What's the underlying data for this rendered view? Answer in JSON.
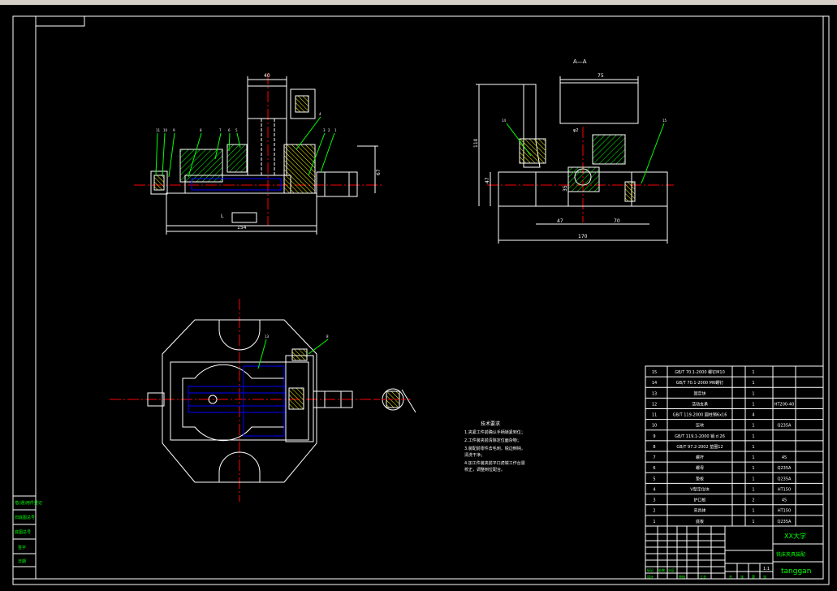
{
  "colors": {
    "background": "#000000",
    "frame": "#ffffff",
    "centerline": "#ff0000",
    "leader": "#00ff00",
    "hidden": "#0000ff",
    "hatch": "#ffff00",
    "title_text": "#00ff00"
  },
  "section_label": "A—A",
  "dimensions": {
    "front": {
      "width_top": "40",
      "width_total": "154",
      "height_right": "67",
      "mark_l": "L"
    },
    "side": {
      "width_top": "75",
      "height_total": "110",
      "height_left": "47",
      "h35": "35",
      "w47": "47",
      "w70": "70",
      "width_total": "170",
      "phi": "φ2"
    },
    "balloons": {
      "front": [
        "11",
        "10",
        "9",
        "8",
        "7",
        "6",
        "5",
        "4",
        "3",
        "2",
        "1"
      ],
      "side": [
        "14",
        "15"
      ],
      "top": [
        "13",
        "8"
      ]
    }
  },
  "notes": {
    "title": "技术要求",
    "lines": [
      "1.夹紧工件前确认手柄锁紧到位；",
      "2.工件装夹前清除定位面杂物；",
      "3.装配前零件去毛刺，锐边倒钝，",
      "  清洗干净；",
      "4.加工件装夹前平口虎钳工作台需",
      "  校正，调整到位配合。"
    ]
  },
  "bom": {
    "rows": [
      {
        "no": "15",
        "std": "GB/T 70.1-2000  螺钉M10",
        "qty": "1",
        "mat": "",
        "note": ""
      },
      {
        "no": "14",
        "std": "GB/T 70.1-2000  M6螺钉",
        "qty": "1",
        "mat": "",
        "note": ""
      },
      {
        "no": "13",
        "std": "固定块",
        "qty": "1",
        "mat": "",
        "note": ""
      },
      {
        "no": "12",
        "std": "活动支承",
        "qty": "1",
        "mat": "HT200-40",
        "note": ""
      },
      {
        "no": "11",
        "std": "GB/T 119-2000  圆柱销6x16",
        "qty": "4",
        "mat": "",
        "note": ""
      },
      {
        "no": "10",
        "std": "压块",
        "qty": "1",
        "mat": "Q235A",
        "note": ""
      },
      {
        "no": "9",
        "std": "GB/T 119.1-2000  销 d 26",
        "qty": "1",
        "mat": "",
        "note": ""
      },
      {
        "no": "8",
        "std": "GB/T 97.2-2002  垫圈12",
        "qty": "1",
        "mat": "",
        "note": ""
      },
      {
        "no": "7",
        "std": "螺杆",
        "qty": "1",
        "mat": "45",
        "note": ""
      },
      {
        "no": "6",
        "std": "螺母",
        "qty": "1",
        "mat": "Q235A",
        "note": ""
      },
      {
        "no": "5",
        "std": "垫板",
        "qty": "1",
        "mat": "Q235A",
        "note": ""
      },
      {
        "no": "4",
        "std": "V型定位块",
        "qty": "1",
        "mat": "HT150",
        "note": ""
      },
      {
        "no": "3",
        "std": "护口板",
        "qty": "2",
        "mat": "45",
        "note": ""
      },
      {
        "no": "2",
        "std": "夹具体",
        "qty": "1",
        "mat": "HT150",
        "note": ""
      },
      {
        "no": "1",
        "std": "底板",
        "qty": "1",
        "mat": "Q235A",
        "note": ""
      }
    ]
  },
  "title_block": {
    "school": "XX大学",
    "drawing_name": "铣床夹具装配",
    "scale": "1:1",
    "designer": "tanggan",
    "footer_cells": [
      "共",
      "张",
      "第",
      "张"
    ],
    "left_cells": [
      "标记",
      "处数",
      "分区",
      "设计",
      "审核",
      "工艺"
    ]
  },
  "side_labels": [
    "借(通)用件登记",
    "旧底图总号",
    "底图总号",
    "签字",
    "日期"
  ]
}
